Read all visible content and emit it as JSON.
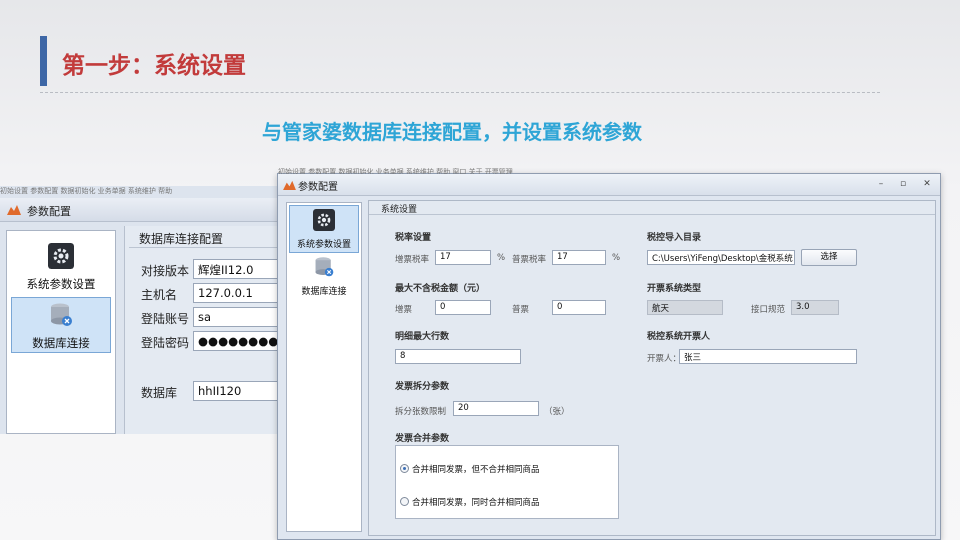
{
  "slide": {
    "title": "第一步：系统设置",
    "subtitle": "与管家婆数据库连接配置，并设置系统参数"
  },
  "back_window": {
    "menu_strip": "初始设置   参数配置   数据初始化   业务单据   系统维护   帮助",
    "title": "参数配置",
    "nav": [
      {
        "label": "系统参数设置",
        "icon": "gear-icon"
      },
      {
        "label": "数据库连接",
        "icon": "database-plug-icon",
        "selected": true
      }
    ],
    "panel_title": "数据库连接配置",
    "fields": {
      "version_label": "对接版本",
      "version_value": "辉煌II12.0",
      "host_label": "主机名",
      "host_value": "127.0.0.1",
      "account_label": "登陆账号",
      "account_value": "sa",
      "password_label": "登陆密码",
      "password_value": "●●●●●●●●●●●●",
      "db_label": "数据库",
      "db_value": "hhII120"
    }
  },
  "front_window": {
    "menu_strip": "初始设置   参数配置   数据初始化   业务单据   系统维护   帮助   窗口   关于   开票管理",
    "title": "参数配置",
    "controls": {
      "minimize": "–",
      "restore": "▫",
      "close": "✕"
    },
    "nav": [
      {
        "label": "系统参数设置",
        "icon": "gear-icon",
        "selected": true
      },
      {
        "label": "数据库连接",
        "icon": "database-plug-icon"
      }
    ],
    "panel_title": "系统设置",
    "tax": {
      "section": "税率设置",
      "vat_label": "增票税率",
      "vat_value": "17",
      "vat_unit": "%",
      "normal_label": "普票税率",
      "normal_value": "17",
      "normal_unit": "%"
    },
    "max_amount": {
      "section": "最大不含税金额（元）",
      "vat_label": "增票",
      "vat_value": "0",
      "normal_label": "普票",
      "normal_value": "0"
    },
    "max_rows": {
      "section": "明细最大行数",
      "value": "8"
    },
    "split": {
      "section": "发票拆分参数",
      "label": "拆分张数限制",
      "value": "20",
      "unit": "（张）"
    },
    "merge": {
      "section": "发票合并参数",
      "options": [
        {
          "label": "合并相同发票，但不合并相同商品",
          "selected": true
        },
        {
          "label": "合并相同发票，同时合并相同商品",
          "selected": false
        }
      ]
    },
    "import_dir": {
      "section": "税控导入目录",
      "value": "C:\\Users\\YiFeng\\Desktop\\金税系统",
      "button": "选择"
    },
    "system_type": {
      "section": "开票系统类型",
      "value": "航天",
      "spec_label": "接口规范",
      "spec_value": "3.0"
    },
    "issuer": {
      "section": "税控系统开票人",
      "label": "开票人：",
      "value": "张三"
    }
  },
  "colors": {
    "title_red": "#c23b3b",
    "subtitle_blue": "#2ea5d6",
    "accent_bar": "#3e67a6",
    "nav_selected": "#cfe3f7"
  }
}
